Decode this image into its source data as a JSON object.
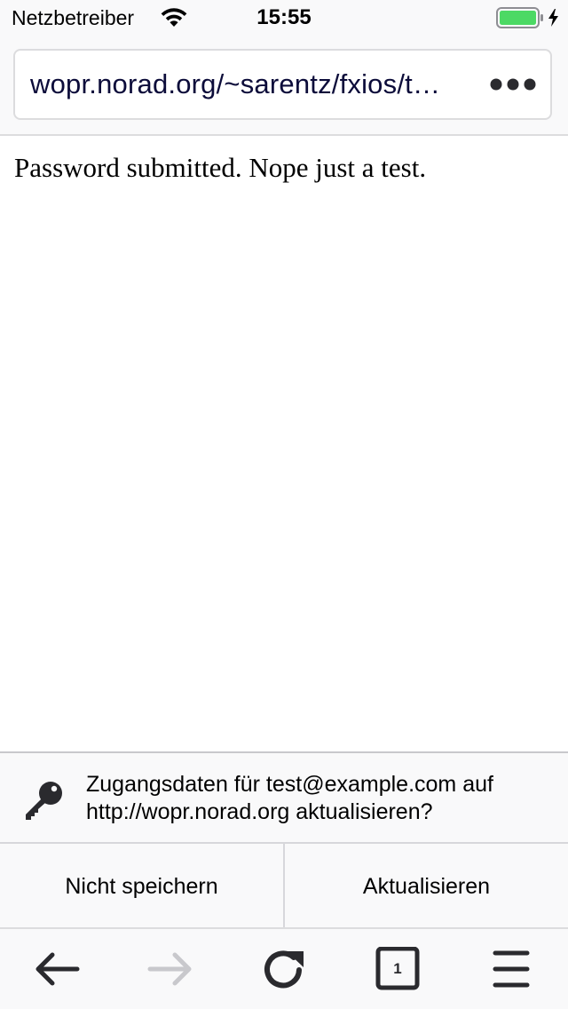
{
  "status_bar": {
    "carrier": "Netzbetreiber",
    "time": "15:55",
    "wifi_icon": "wifi-icon",
    "battery_icon": "battery-charging-icon",
    "battery_color": "#4cd964"
  },
  "url_bar": {
    "url": "wopr.norad.org/~sarentz/fxios/t…",
    "more_icon": "more-dots-icon"
  },
  "page": {
    "text": "Password submitted. Nope just a test."
  },
  "login_prompt": {
    "icon": "key-icon",
    "message": "Zugangsdaten für test@example.com auf http://wopr.norad.org aktualisieren?",
    "dont_save_label": "Nicht speichern",
    "update_label": "Aktualisieren"
  },
  "bottom_toolbar": {
    "back_icon": "back-arrow-icon",
    "forward_icon": "forward-arrow-icon",
    "reload_icon": "reload-icon",
    "tabs_icon": "tabs-icon",
    "tabs_count": "1",
    "menu_icon": "menu-icon"
  },
  "colors": {
    "toolbar_background": "#f9f9fa",
    "url_text": "#0c0c3a",
    "icon_active": "#2a2a2e",
    "icon_disabled": "#c8c8cc"
  }
}
